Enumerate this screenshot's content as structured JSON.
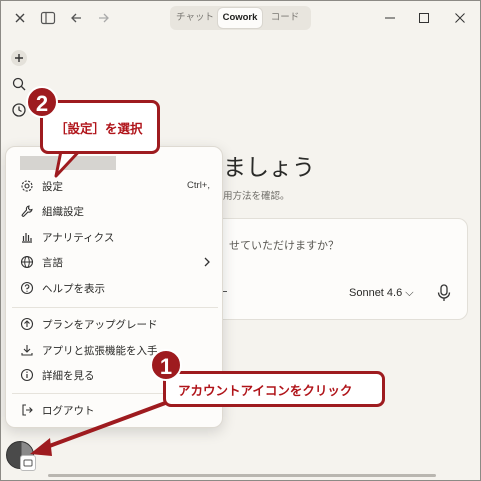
{
  "titlebar": {
    "tabs": [
      {
        "label": "チャット",
        "active": false
      },
      {
        "label": "Cowork",
        "active": true
      },
      {
        "label": "コード",
        "active": false
      }
    ]
  },
  "main": {
    "greeting": "ましょう",
    "subtext": "用方法を確認。",
    "composer_text": "せていただけますか？",
    "model": "Sonnet 4.6 ⌵"
  },
  "menu": {
    "items": [
      {
        "label": "設定",
        "shortcut": "Ctrl+,",
        "icon": "gear-icon"
      },
      {
        "label": "組織設定",
        "icon": "wrench-icon"
      },
      {
        "label": "アナリティクス",
        "icon": "bar-chart-icon"
      },
      {
        "label": "言語",
        "icon": "globe-icon",
        "submenu": true
      },
      {
        "label": "ヘルプを表示",
        "icon": "help-icon"
      },
      {
        "label": "プランをアップグレード",
        "icon": "upgrade-icon"
      },
      {
        "label": "アプリと拡張機能を入手",
        "icon": "download-icon"
      },
      {
        "label": "詳細を見る",
        "icon": "info-icon"
      },
      {
        "label": "ログアウト",
        "icon": "logout-icon"
      }
    ]
  },
  "annotations": {
    "step2": {
      "number": "2",
      "text": "［設定］を選択"
    },
    "step1": {
      "number": "1",
      "text": "アカウントアイコンをクリック"
    }
  },
  "colors": {
    "background": "#f5f3ee",
    "annotation_red": "#9e1b1f",
    "menu_bg": "#fdfcfa"
  }
}
